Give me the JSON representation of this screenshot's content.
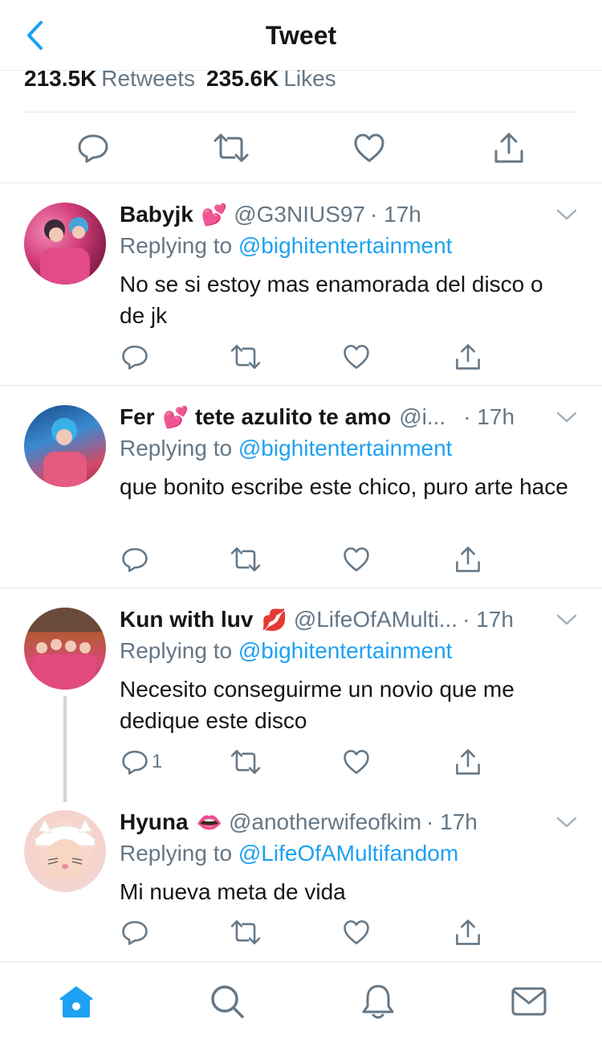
{
  "header": {
    "title": "Tweet",
    "back_icon": "chevron-left-icon"
  },
  "stats": {
    "retweets_count": "213.5K",
    "retweets_label": "Retweets",
    "likes_count": "235.6K",
    "likes_label": "Likes"
  },
  "main_actions": [
    "reply-icon",
    "retweet-icon",
    "like-icon",
    "share-icon"
  ],
  "replies": [
    {
      "display_name": "Babyjk",
      "emoji": "💕",
      "handle": "@G3NIUS97",
      "time": "· 17h",
      "replying_label": "Replying to",
      "replying_to": "@bighitentertainment",
      "text": "No se si estoy mas enamorada del disco o de jk",
      "reply_count": ""
    },
    {
      "display_name": "Fer",
      "emoji": "💕",
      "name_suffix": "tete azulito te amo",
      "handle": "@i...",
      "time": "· 17h",
      "replying_label": "Replying to",
      "replying_to": "@bighitentertainment",
      "text": "que bonito escribe este chico, puro arte hace",
      "reply_count": ""
    },
    {
      "display_name": "Kun with luv",
      "emoji": "💋",
      "handle": "@LifeOfAMulti...",
      "time": "· 17h",
      "replying_label": "Replying to",
      "replying_to": "@bighitentertainment",
      "text": "Necesito conseguirme un novio que me dedique este disco",
      "reply_count": "1"
    },
    {
      "display_name": "Hyuna",
      "emoji": "👄",
      "handle": "@anotherwifeofkim",
      "time": "· 17h",
      "replying_label": "Replying to",
      "replying_to": "@LifeOfAMultifandom",
      "text": "Mi nueva meta de vida",
      "reply_count": ""
    }
  ],
  "tabbar": [
    "home-icon",
    "search-icon",
    "notifications-icon",
    "messages-icon"
  ],
  "colors": {
    "accent": "#1da1f2",
    "secondary_text": "#657786",
    "icon_gray": "#657786",
    "divider": "#e1e8ed"
  }
}
